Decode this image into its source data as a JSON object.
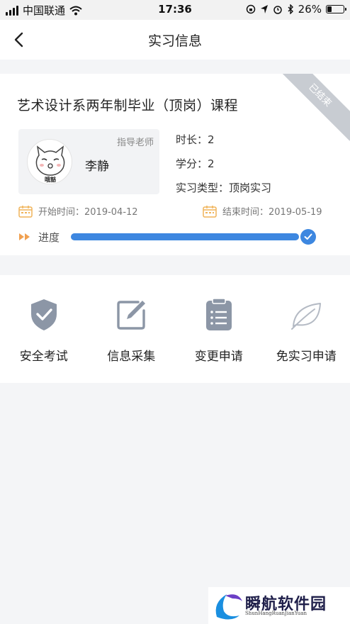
{
  "status_bar": {
    "carrier": "中国联通",
    "time": "17:36",
    "battery": "26%",
    "battery_level": 0.26
  },
  "nav": {
    "title": "实习信息",
    "back_icon": "chevron-left-icon"
  },
  "card": {
    "course_title": "艺术设计系两年制毕业（顶岗）课程",
    "status_ribbon": "已结束",
    "teacher": {
      "role": "指导老师",
      "name": "李静",
      "avatar_text": "哦豁"
    },
    "duration": "时长：2",
    "credit": "学分：2",
    "type": "实习类型：顶岗实习",
    "start": "开始时间：2019-04-12",
    "end": "结束时间：2019-05-19",
    "progress_label": "进度",
    "progress": 1.0
  },
  "actions": [
    {
      "label": "安全考试",
      "icon": "shield-check-icon"
    },
    {
      "label": "信息采集",
      "icon": "edit-icon"
    },
    {
      "label": "变更申请",
      "icon": "clipboard-icon"
    },
    {
      "label": "免实习申请",
      "icon": "leaf-icon"
    }
  ],
  "watermark": {
    "title": "瞬航软件园",
    "subtitle": "ShunHangRuanJianYuan"
  },
  "colors": {
    "accent": "#3d87e0",
    "ribbon": "#c8ccd2",
    "calendar": "#f0b45a",
    "icon_gray": "#8c96a6"
  }
}
